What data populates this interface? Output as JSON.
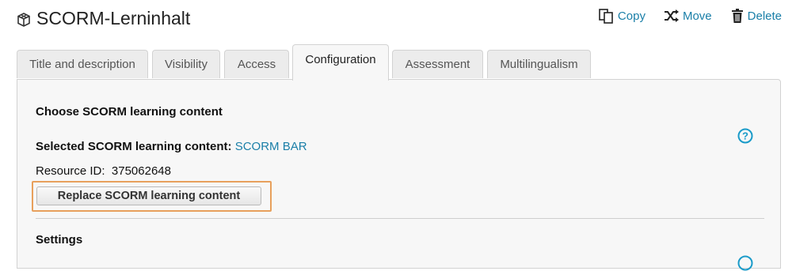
{
  "header": {
    "title": "SCORM-Lerninhalt",
    "icon": "cube-icon"
  },
  "actions": [
    {
      "label": "Copy",
      "icon": "copy-icon"
    },
    {
      "label": "Move",
      "icon": "shuffle-icon"
    },
    {
      "label": "Delete",
      "icon": "trash-icon"
    }
  ],
  "tabs": [
    {
      "label": "Title and description",
      "active": false
    },
    {
      "label": "Visibility",
      "active": false
    },
    {
      "label": "Access",
      "active": false
    },
    {
      "label": "Configuration",
      "active": true
    },
    {
      "label": "Assessment",
      "active": false
    },
    {
      "label": "Multilingualism",
      "active": false
    }
  ],
  "panel": {
    "choose_title": "Choose SCORM learning content",
    "selected_label": "Selected SCORM learning content:",
    "selected_value": "SCORM BAR",
    "resource_label": "Resource ID:",
    "resource_value": "375062648",
    "replace_button": "Replace SCORM learning content",
    "settings_title": "Settings"
  },
  "colors": {
    "accent": "#1a7fa8",
    "highlight": "#e8a05c"
  }
}
